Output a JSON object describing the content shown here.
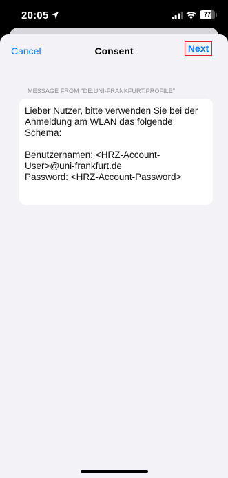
{
  "status_bar": {
    "time": "20:05",
    "battery_level": "77",
    "battery_fraction": 0.77,
    "icons": [
      "location-arrow-icon",
      "cellular-signal-icon",
      "wifi-icon",
      "battery-icon"
    ]
  },
  "nav": {
    "cancel_label": "Cancel",
    "title": "Consent",
    "next_label": "Next"
  },
  "message": {
    "header": "MESSAGE FROM \"DE.UNI-FRANKFURT.PROFILE\"",
    "body": "Lieber Nutzer, bitte verwenden Sie bei der Anmeldung am WLAN das folgende Schema:\n\nBenutzernamen:   <HRZ-Account-User>@uni-frankfurt.de\nPassword:           <HRZ-Account-Password>"
  },
  "colors": {
    "accent": "#007aff",
    "highlight_border": "#e0242f",
    "sheet_background": "#f2f2f7"
  }
}
